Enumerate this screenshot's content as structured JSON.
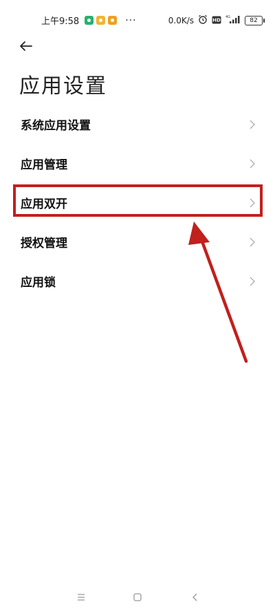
{
  "status_bar": {
    "time": "上午9:58",
    "more": "···",
    "network_speed": "0.0K/s",
    "hd_label": "HD",
    "signal_label": "4G",
    "battery_level": "82",
    "icons": [
      "app-green-icon",
      "app-yellow-icon",
      "app-weibo-icon",
      "alarm-icon",
      "hd-icon",
      "signal-icon",
      "battery-icon"
    ]
  },
  "header": {
    "back_icon": "back-arrow-icon",
    "title": "应用设置"
  },
  "menu": {
    "items": [
      {
        "label": "系统应用设置"
      },
      {
        "label": "应用管理"
      },
      {
        "label": "应用双开",
        "highlighted": true
      },
      {
        "label": "授权管理"
      },
      {
        "label": "应用锁"
      }
    ]
  },
  "annotation": {
    "color": "#c0201e",
    "highlighted_item": "应用双开"
  },
  "nav_bar": {
    "icons": [
      "menu-icon",
      "home-icon",
      "back-icon"
    ]
  }
}
